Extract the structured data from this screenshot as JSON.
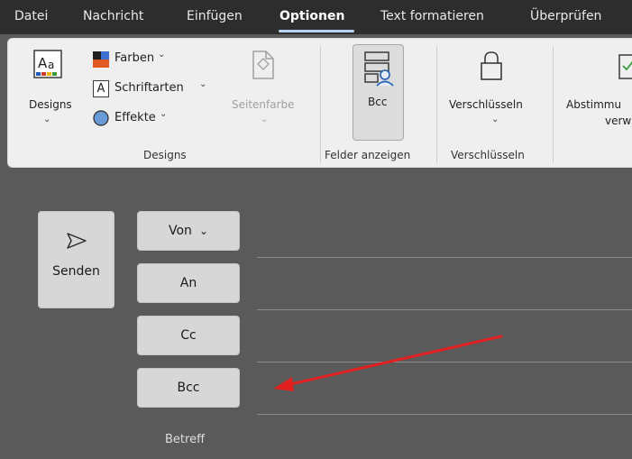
{
  "menu": {
    "tabs": [
      {
        "label": "Datei"
      },
      {
        "label": "Nachricht"
      },
      {
        "label": "Einfügen"
      },
      {
        "label": "Optionen",
        "active": true
      },
      {
        "label": "Text formatieren"
      },
      {
        "label": "Überprüfen"
      }
    ]
  },
  "ribbon": {
    "designs": {
      "designs_label": "Designs",
      "farben": "Farben",
      "schriftarten": "Schriftarten",
      "effekte": "Effekte",
      "seitenfarbe": "Seitenfarbe",
      "group_label": "Designs"
    },
    "felder": {
      "bcc": "Bcc",
      "group_label": "Felder anzeigen"
    },
    "verschluesseln": {
      "button": "Verschlüsseln",
      "group_label": "Verschlüsseln"
    },
    "abstimmung": {
      "line1": "Abstimmu",
      "line2": "verw"
    }
  },
  "compose": {
    "send": "Senden",
    "von": "Von",
    "an": "An",
    "cc": "Cc",
    "bcc": "Bcc",
    "betreff": "Betreff"
  },
  "icons": {
    "send": "send-icon",
    "designs": "designs-icon",
    "farben": "color-swatch-icon",
    "schriftarten": "font-a-icon",
    "effekte": "effects-icon",
    "seitenfarbe": "page-color-icon",
    "bcc": "bcc-field-icon",
    "lock": "lock-icon",
    "voting": "voting-icon",
    "arrow": "red-arrow-annotation"
  },
  "colors": {
    "menubar_bg": "#2d2d2d",
    "ribbon_bg": "#efefef",
    "compose_bg": "#5a5a5a",
    "button_bg": "#d7d7d7",
    "annotation_arrow": "#e02020",
    "active_tab_underline": "#b5d3f2"
  }
}
